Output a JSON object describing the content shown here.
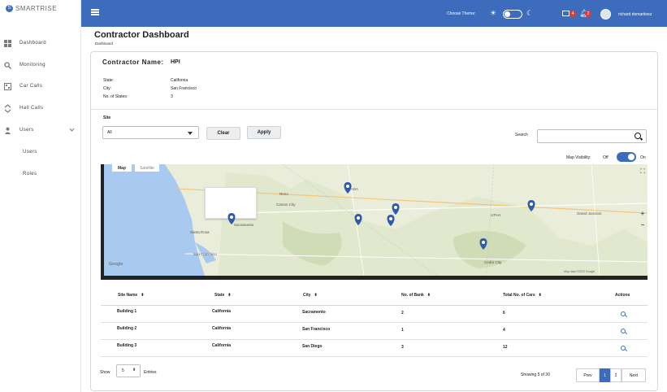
{
  "app": {
    "logo_text": "SMARTRISE"
  },
  "sidebar": {
    "items": [
      {
        "label": "Dashboard",
        "icon": "dashboard-icon"
      },
      {
        "label": "Monitoring",
        "icon": "search-icon"
      },
      {
        "label": "Car Calls",
        "icon": "car-calls-icon"
      },
      {
        "label": "Hall Calls",
        "icon": "up-down-icon"
      },
      {
        "label": "Users",
        "icon": "user-icon"
      },
      {
        "label": "Users",
        "icon": ""
      },
      {
        "label": "Roles",
        "icon": ""
      }
    ]
  },
  "topbar": {
    "choose_theme": "Choose Theme:",
    "mail_count": "4",
    "notification_count": "2",
    "user_name": "richard demartinez"
  },
  "page": {
    "title": "Contractor Dashboard",
    "breadcrumb": "Dashboard"
  },
  "contractor": {
    "name_label": "Contractor Name:",
    "name_value": "HPI",
    "state_label": "State:",
    "state_value": "California",
    "city_label": "City:",
    "city_value": "San Francisco",
    "num_states_label": "No. of States:",
    "num_states_value": "3"
  },
  "filters": {
    "site_label": "Site",
    "site_value": "All",
    "clear_label": "Clear",
    "apply_label": "Apply",
    "search_label": "Search",
    "search_value": "",
    "map_visibility_label": "Map Visibility:",
    "off_label": "Off",
    "on_label": "On"
  },
  "map": {
    "tab_map": "Map",
    "tab_satellite": "Satellite",
    "places": [
      "EVADA",
      "UTAH",
      "Sacramento",
      "Santa Rosa",
      "San Francisco",
      "Reno",
      "Carson City",
      "Cedar City",
      "Grand Junction"
    ],
    "google": "Google",
    "credit": "Map data ©2023 Google"
  },
  "table": {
    "headers": [
      "Site Name",
      "State",
      "City",
      "No. of Bank",
      "Total No. of Cars",
      "Actions"
    ],
    "rows": [
      [
        "Building 1",
        "California",
        "Sacramento",
        "2",
        "6"
      ],
      [
        "Building 2",
        "California",
        "San Francisco",
        "1",
        "4"
      ],
      [
        "Building 3",
        "California",
        "San Diego",
        "3",
        "12"
      ]
    ]
  },
  "footer": {
    "show_label": "Show",
    "entries_value": "5",
    "entries_label": "Entries",
    "showing_text": "Showing 5 of 30",
    "prev_label": "Prev",
    "page1": "1",
    "page2": "2",
    "next_label": "Next"
  },
  "colors": {
    "accent": "#3e6cbc",
    "badge": "#e53935"
  }
}
